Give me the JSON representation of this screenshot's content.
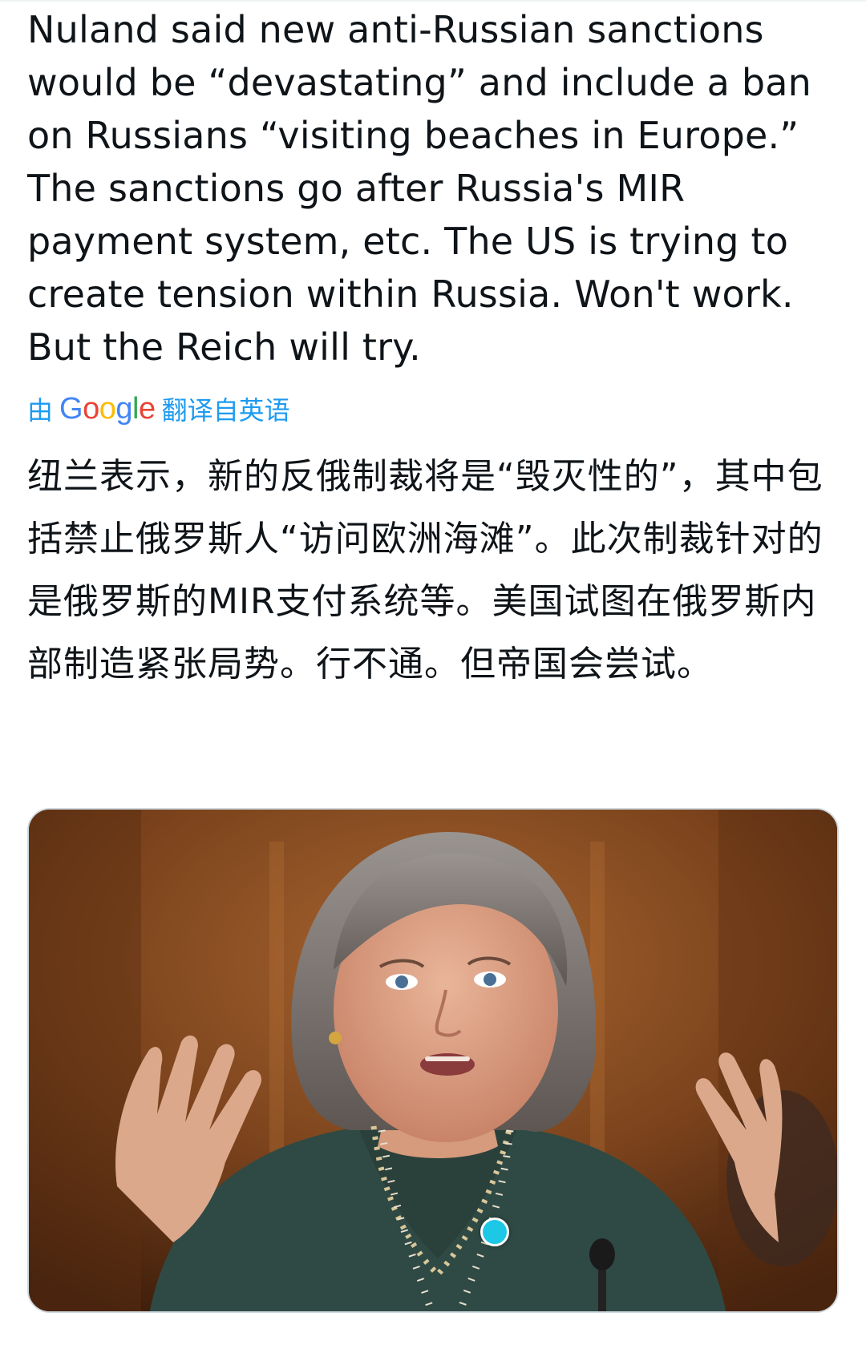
{
  "tweet": {
    "text": "Nuland said new anti-Russian sanctions\nwould be “devastating” and include a ban\non Russians “visiting beaches in Europe.”\nThe sanctions go after Russia's MIR\npayment system, etc.  The US is trying to\ncreate tension within Russia.  Won't work.\nBut the Reich will try.",
    "translation_prefix": "由",
    "translation_brand": "Google",
    "translation_suffix": "翻译自英语",
    "translated_text": "纽兰表示，新的反俄制裁将是“毁灭性的”，其中包括禁止俄罗斯人“访问欧洲海滩”。此次制裁针对的是俄罗斯的MIR支付系统等。美国试图在俄罗斯内部制造紧张局势。行不通。但帝国会尝试。"
  },
  "media": {
    "subject": "photo-woman-speaking-at-hearing"
  },
  "colors": {
    "link": "#1d9bf0",
    "text": "#0f1419",
    "indicator": "#1dc7e6"
  }
}
